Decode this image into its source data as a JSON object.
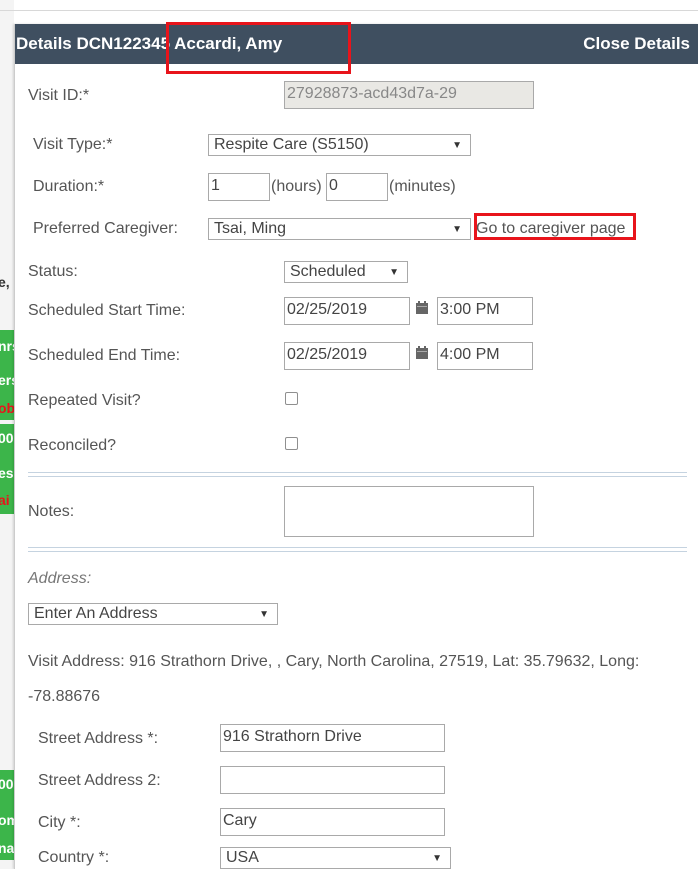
{
  "background": {
    "cells": [
      {
        "text": "e,",
        "style": "plain"
      },
      {
        "text": "nrs",
        "style": "green"
      },
      {
        "text": "ers",
        "style": "green"
      },
      {
        "text": "ob",
        "style": "green-red"
      },
      {
        "text": "00",
        "style": "green"
      },
      {
        "text": "esp",
        "style": "green"
      },
      {
        "text": "ai",
        "style": "green-red"
      },
      {
        "text": "00",
        "style": "green"
      },
      {
        "text": "om",
        "style": "green"
      },
      {
        "text": "na",
        "style": "green"
      }
    ]
  },
  "panel": {
    "title": "Details DCN122345 Accardi, Amy",
    "close_label": "Close Details",
    "colors": {
      "header_bg": "#3f4f60",
      "highlight": "#e8141b",
      "green": "#3cb54a"
    }
  },
  "form": {
    "visit_id": {
      "label": "Visit ID:*",
      "value": "27928873-acd43d7a-29"
    },
    "visit_type": {
      "label": "Visit Type:*",
      "value": "Respite Care (S5150)"
    },
    "duration": {
      "label": "Duration:*",
      "hours": "1",
      "hours_unit": "(hours)",
      "minutes": "0",
      "minutes_unit": "(minutes)"
    },
    "preferred_caregiver": {
      "label": "Preferred Caregiver:",
      "value": "Tsai, Ming",
      "link": "Go to caregiver page"
    },
    "status": {
      "label": "Status:",
      "value": "Scheduled"
    },
    "scheduled_start": {
      "label": "Scheduled Start Time:",
      "date": "02/25/2019",
      "time": "3:00 PM"
    },
    "scheduled_end": {
      "label": "Scheduled End Time:",
      "date": "02/25/2019",
      "time": "4:00 PM"
    },
    "repeated_visit": {
      "label": "Repeated Visit?",
      "checked": false
    },
    "reconciled": {
      "label": "Reconciled?",
      "checked": false
    },
    "notes": {
      "label": "Notes:",
      "value": ""
    },
    "address": {
      "label": "Address:",
      "select": "Enter An Address",
      "visit_address_line1": "Visit Address: 916 Strathorn Drive, , Cary, North Carolina, 27519, Lat: 35.79632, Long:",
      "visit_address_line2": "-78.88676",
      "street_label": "Street Address *:",
      "street_value": "916 Strathorn Drive",
      "street2_label": "Street Address 2:",
      "street2_value": "",
      "city_label": "City *:",
      "city_value": "Cary",
      "country_label": "Country *:",
      "country_value": "USA"
    }
  }
}
